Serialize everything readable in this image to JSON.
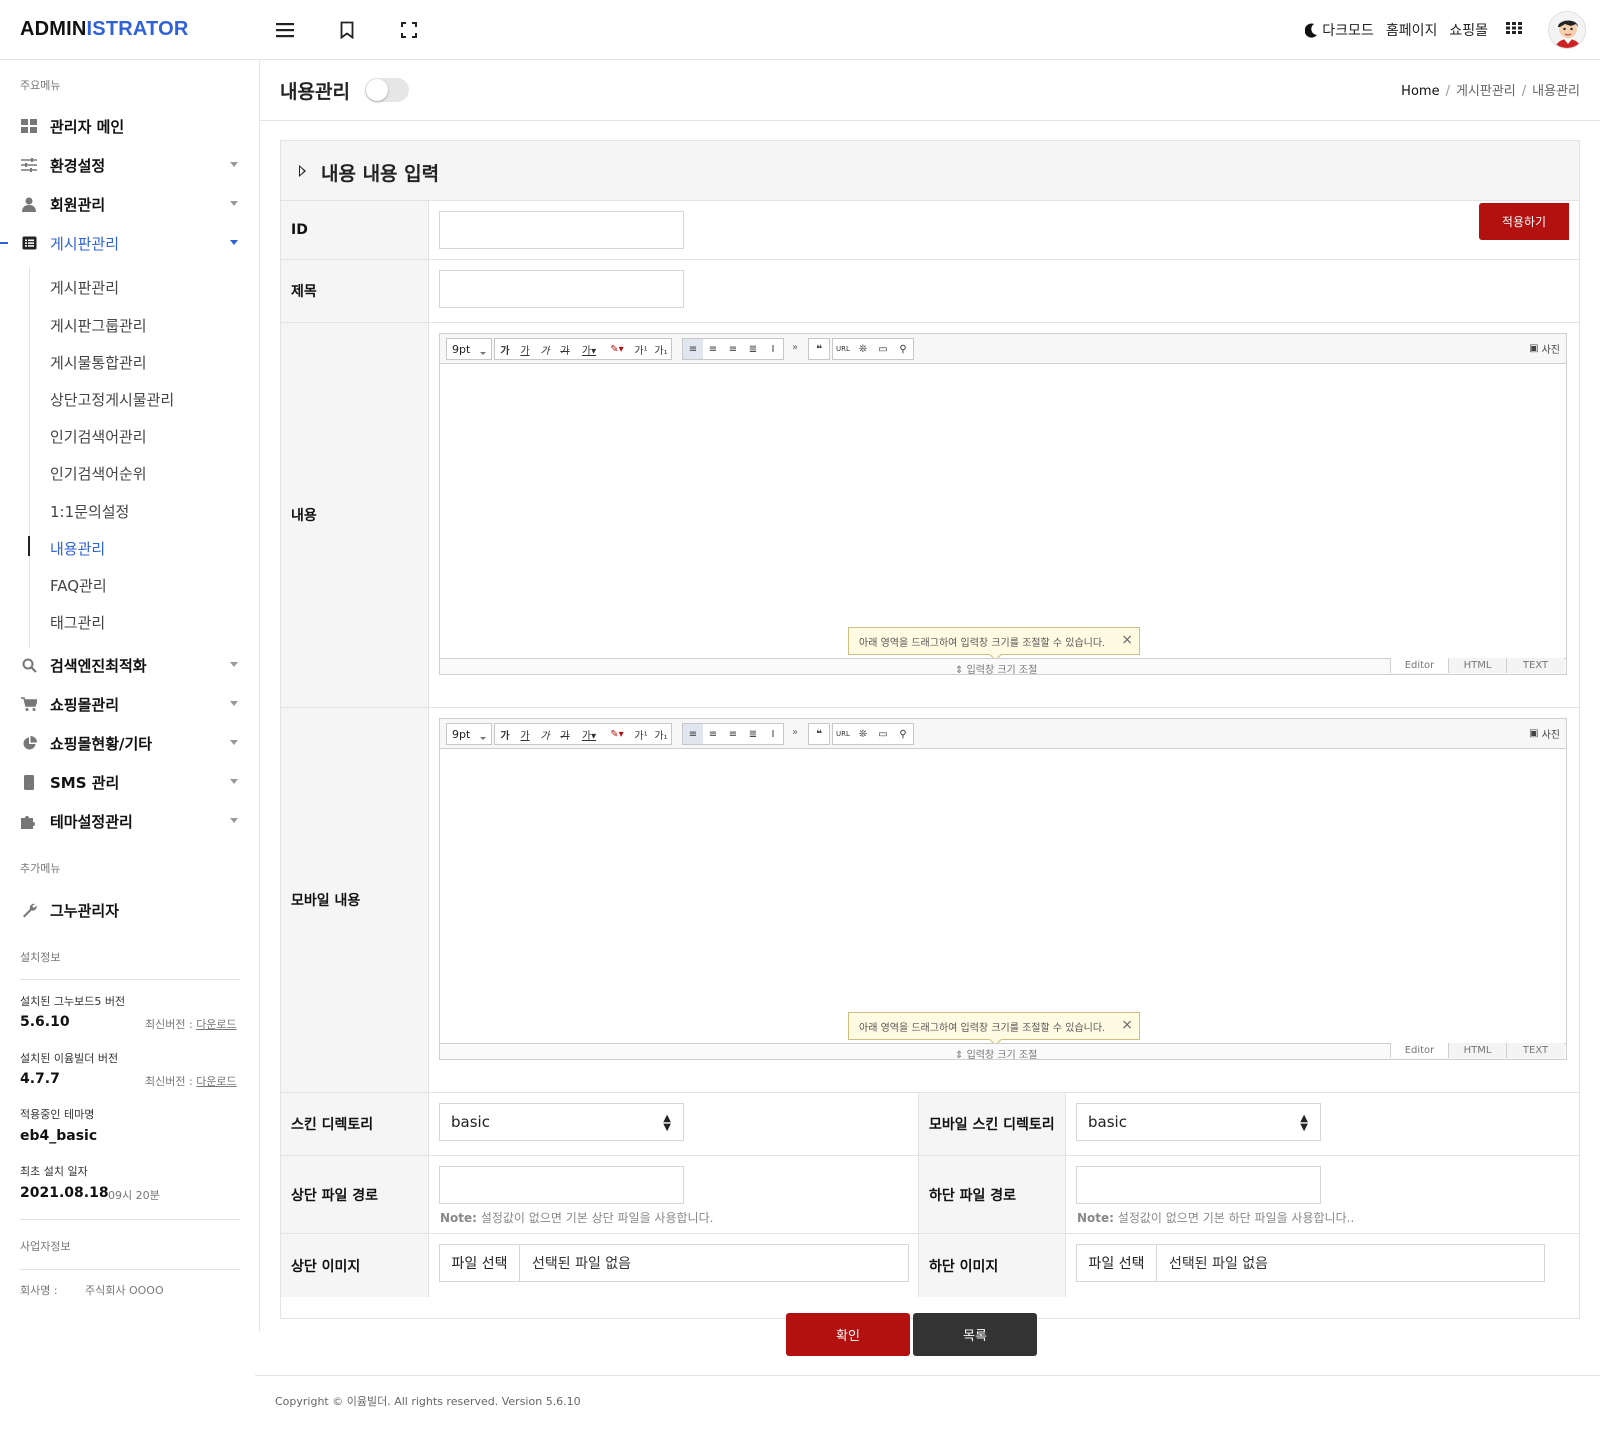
{
  "header": {
    "logo_a": "ADMIN",
    "logo_b": "ISTRATOR",
    "dark_mode": "다크모드",
    "homepage": "홈페이지",
    "shop": "쇼핑몰"
  },
  "sidebar": {
    "main_section": "주요메뉴",
    "items": [
      {
        "label": "관리자 메인",
        "icon": "grid-icon"
      },
      {
        "label": "환경설정",
        "icon": "sliders-icon"
      },
      {
        "label": "회원관리",
        "icon": "user-icon"
      },
      {
        "label": "게시판관리",
        "icon": "list-icon"
      },
      {
        "label": "검색엔진최적화",
        "icon": "search-icon"
      },
      {
        "label": "쇼핑몰관리",
        "icon": "cart-icon"
      },
      {
        "label": "쇼핑몰현황/기타",
        "icon": "pie-chart-icon"
      },
      {
        "label": "SMS 관리",
        "icon": "phone-icon"
      },
      {
        "label": "테마설정관리",
        "icon": "puzzle-icon"
      }
    ],
    "sub_items": [
      "게시판관리",
      "게시판그룹관리",
      "게시물통합관리",
      "상단고정게시물관리",
      "인기검색어관리",
      "인기검색어순위",
      "1:1문의설정",
      "내용관리",
      "FAQ관리",
      "태그관리"
    ],
    "extra_section": "추가메뉴",
    "extra_item": "그누관리자",
    "install_section": "설치정보",
    "gnuboard_label": "설치된 그누보드5 버전",
    "gnuboard_version": "5.6.10",
    "latest_label": "최신버전 :",
    "download": "다운로드",
    "builder_label": "설치된 이윰빌더 버전",
    "builder_version": "4.7.7",
    "theme_label": "적용중인 테마명",
    "theme_value": "eb4_basic",
    "install_date_label": "최초 설치 일자",
    "install_date": "2021.08.18",
    "install_time": "09시 20분",
    "biz_section": "사업자정보",
    "company_label": "회사명 :",
    "company_value": "주식회사 OOOO"
  },
  "page": {
    "title": "내용관리",
    "breadcrumb": [
      "Home",
      "게시판관리",
      "내용관리"
    ]
  },
  "form": {
    "heading": "내용 내용 입력",
    "apply_button": "적용하기",
    "id_label": "ID",
    "subject_label": "제목",
    "content_label": "내용",
    "mobile_content_label": "모바일 내용",
    "skin_label": "스킨 디렉토리",
    "skin_value": "basic",
    "mobile_skin_label": "모바일 스킨 디렉토리",
    "mobile_skin_value": "basic",
    "head_file_label": "상단 파일 경로",
    "tail_file_label": "하단 파일 경로",
    "note_prefix": "Note:",
    "head_note": "설정값이 없으면 기본 상단 파일을 사용합니다.",
    "tail_note": "설정값이 없으면 기본 하단 파일을 사용합니다..",
    "head_image_label": "상단 이미지",
    "tail_image_label": "하단 이미지",
    "file_button": "파일 선택",
    "no_file": "선택된 파일 없음"
  },
  "editor": {
    "font_size": "9pt",
    "photo": "사진",
    "tip": "아래 영역을 드래그하여 입력창 크기를 조절할 수 있습니다.",
    "resize_label": "입력창 크기 조절",
    "mode_editor": "Editor",
    "mode_html": "HTML",
    "mode_text": "TEXT",
    "url": "URL"
  },
  "buttons": {
    "confirm": "확인",
    "list": "목록"
  },
  "footer": {
    "copyright": "Copyright © 이윰빌더. All rights reserved. Version 5.6.10"
  },
  "colors": {
    "brand_blue": "#2f62d8",
    "primary_red": "#b31010",
    "dark_button": "#333333"
  }
}
